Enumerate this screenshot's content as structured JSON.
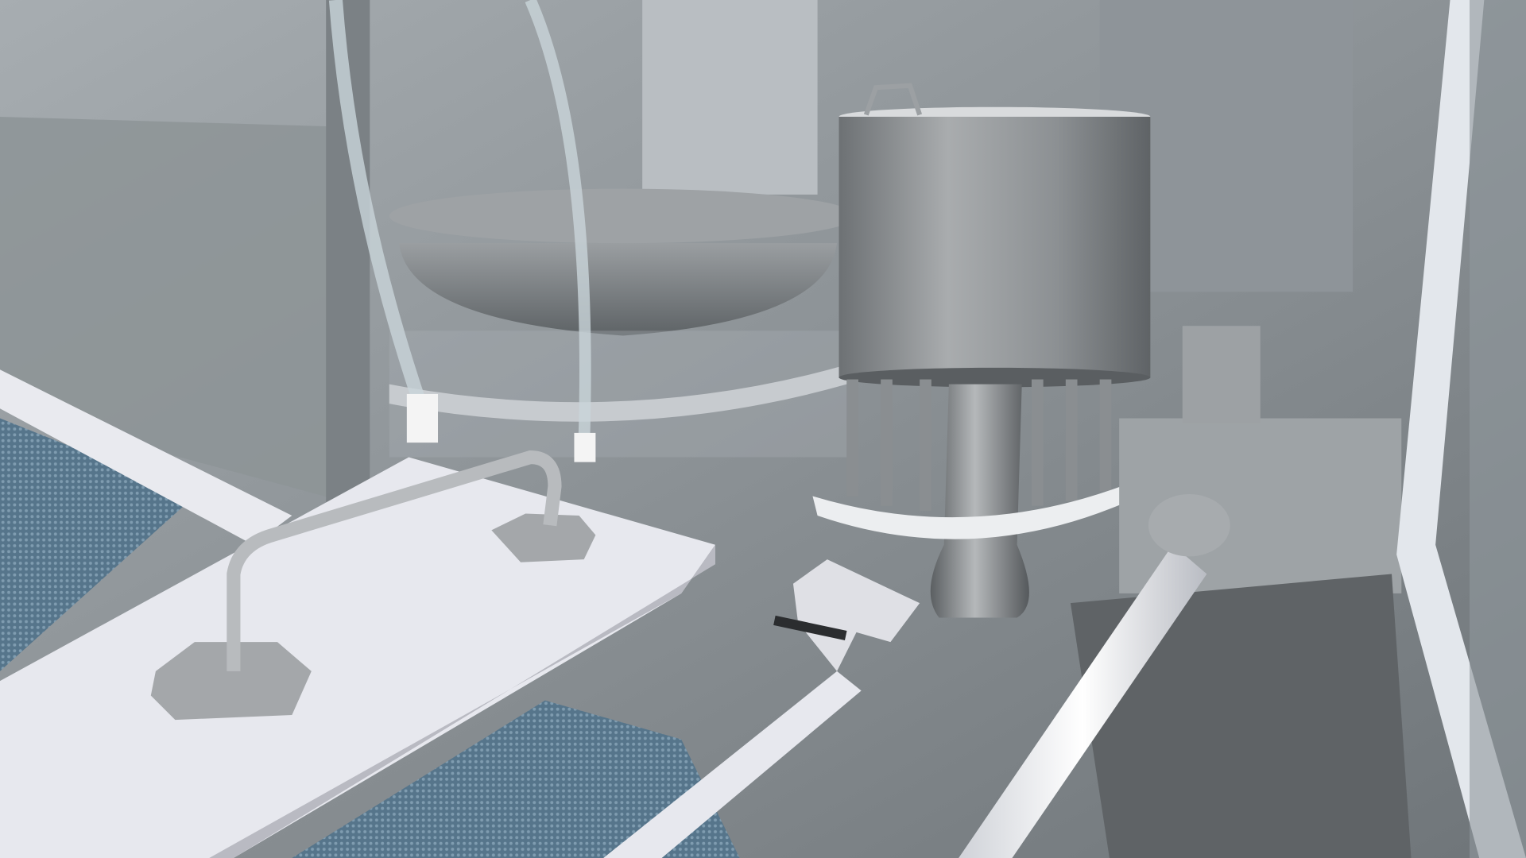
{
  "scene": {
    "colors": {
      "wall": "#8a9094",
      "steel": "#8f9396",
      "steel_light": "#c4c7c9",
      "white_part": "#e8e9ee",
      "conveyor_mesh": "#5f7f95",
      "glass_frame": "#dfe4ea"
    }
  }
}
